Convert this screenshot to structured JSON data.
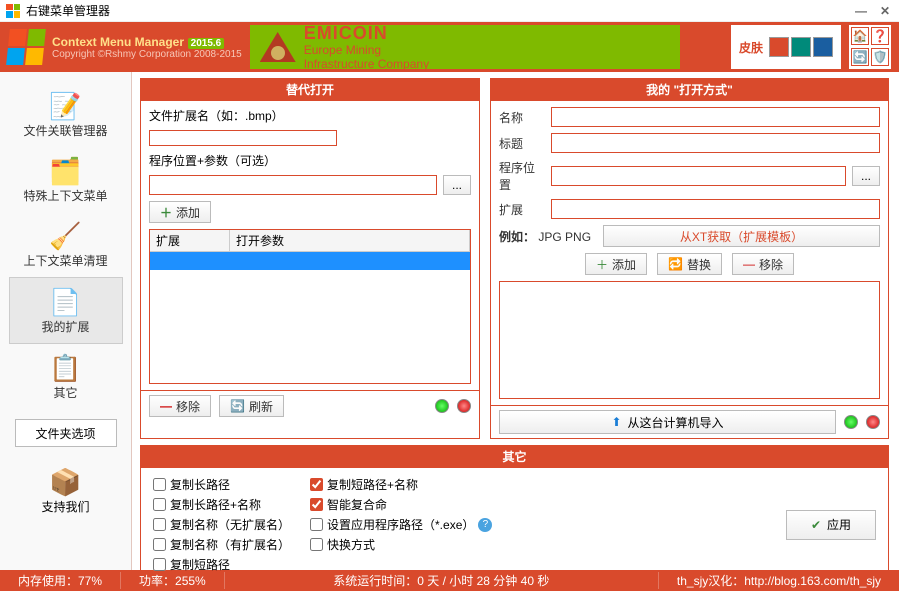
{
  "titlebar": {
    "title": "右键菜单管理器"
  },
  "header": {
    "brand_line1": "Context Menu Manager",
    "version": "2015.6",
    "brand_line2": "Copyright ©Rshmy Corporation 2008-2015",
    "ad_title": "EMICOIN",
    "ad_sub1": "Europe Mining",
    "ad_sub2": "Infrastructure Company",
    "skin_label": "皮肤",
    "skin_colors": [
      "#d94a2c",
      "#008a7a",
      "#1a5ea0"
    ]
  },
  "sidebar": {
    "items": [
      {
        "label": "文件关联管理器",
        "icon": "📝"
      },
      {
        "label": "特殊上下文菜单",
        "icon": "🗂️"
      },
      {
        "label": "上下文菜单清理",
        "icon": "🧹"
      },
      {
        "label": "我的扩展",
        "icon": "📄"
      },
      {
        "label": "其它",
        "icon": "📋"
      }
    ],
    "folder_options": "文件夹选项",
    "support": {
      "label": "支持我们",
      "icon": "📦"
    }
  },
  "panel_replace": {
    "title": "替代打开",
    "ext_label": "文件扩展名（如：.bmp）",
    "ext_value": "",
    "path_label": "程序位置+参数（可选）",
    "path_value": "",
    "add": "添加",
    "col_ext": "扩展",
    "col_params": "打开参数",
    "remove": "移除",
    "refresh": "刷新"
  },
  "panel_openwith": {
    "title": "我的 \"打开方式\"",
    "name_label": "名称",
    "title_label": "标题",
    "path_label": "程序位置",
    "ext_label": "扩展",
    "example_label": "例如：",
    "example_value": "JPG PNG",
    "from_xt": "从XT获取（扩展模板）",
    "add": "添加",
    "replace": "替换",
    "remove": "移除",
    "import": "从这台计算机导入"
  },
  "panel_misc": {
    "title": "其它",
    "col1": [
      {
        "label": "复制长路径",
        "checked": false
      },
      {
        "label": "复制长路径+名称",
        "checked": false
      },
      {
        "label": "复制名称（无扩展名）",
        "checked": false
      },
      {
        "label": "复制名称（有扩展名）",
        "checked": false
      },
      {
        "label": "复制短路径",
        "checked": false
      }
    ],
    "col2": [
      {
        "label": "复制短路径+名称",
        "checked": true,
        "help": false
      },
      {
        "label": "智能复合命",
        "checked": true,
        "help": false
      },
      {
        "label": "设置应用程序路径（*.exe）",
        "checked": false,
        "help": true
      },
      {
        "label": "快换方式",
        "checked": false,
        "help": false
      }
    ],
    "apply": "应用"
  },
  "status": {
    "memory": "内存使用：77%",
    "power": "功率：255%",
    "runtime": "系统运行时间：0 天 / 小时 28 分钟 40 秒",
    "credit": "th_sjy汉化：http://blog.163.com/th_sjy"
  }
}
